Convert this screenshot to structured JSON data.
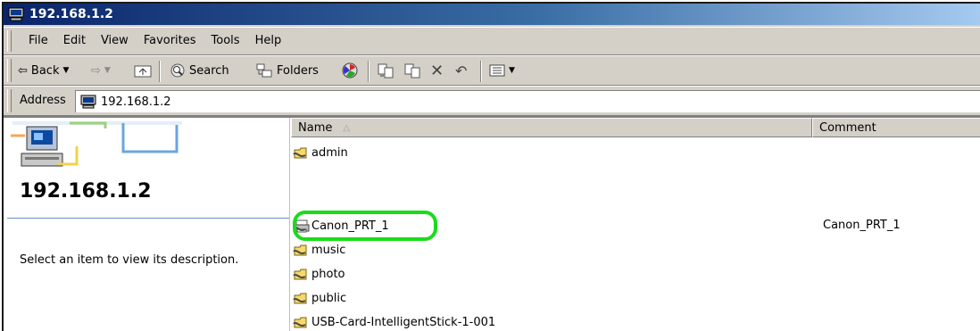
{
  "window": {
    "title": "192.168.1.2"
  },
  "menu": [
    "File",
    "Edit",
    "View",
    "Favorites",
    "Tools",
    "Help"
  ],
  "toolbar": {
    "back": "Back",
    "search": "Search",
    "folders": "Folders"
  },
  "address": {
    "label": "Address",
    "value": "192.168.1.2"
  },
  "left_pane": {
    "title": "192.168.1.2",
    "description": "Select an item to view its description."
  },
  "columns": {
    "name": "Name",
    "comment": "Comment"
  },
  "items": [
    {
      "name": "admin",
      "comment": "",
      "icon": "shared-folder-icon"
    },
    {
      "name": "Canon_PRT_1",
      "comment": "Canon_PRT_1",
      "icon": "shared-printer-icon"
    },
    {
      "name": "music",
      "comment": "",
      "icon": "shared-folder-icon"
    },
    {
      "name": "photo",
      "comment": "",
      "icon": "shared-folder-icon"
    },
    {
      "name": "public",
      "comment": "",
      "icon": "shared-folder-icon"
    },
    {
      "name": "USB-Card-IntelligentStick-1-001",
      "comment": "",
      "icon": "shared-folder-icon"
    }
  ],
  "colors": {
    "highlight": "#19dc19",
    "titlebar": "#0a246a"
  }
}
